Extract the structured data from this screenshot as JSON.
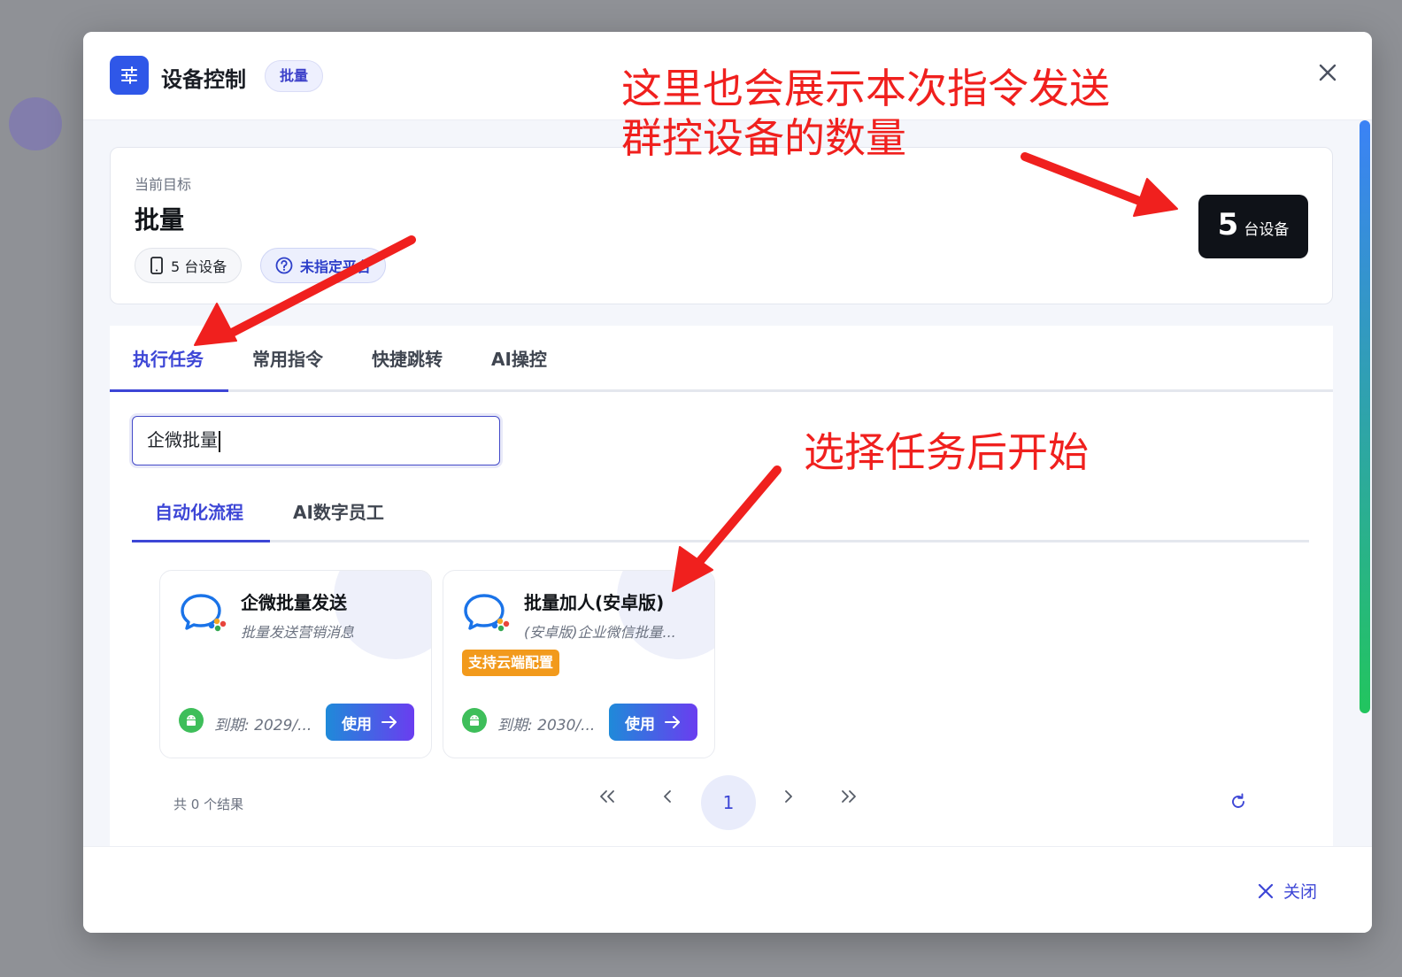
{
  "header": {
    "title": "设备控制",
    "badge": "批量"
  },
  "target": {
    "label": "当前目标",
    "name": "批量",
    "device_chip": "5 台设备",
    "platform_chip": "未指定平台",
    "count_number": "5",
    "count_unit": "台设备"
  },
  "tabs": {
    "items": [
      {
        "label": "执行任务"
      },
      {
        "label": "常用指令"
      },
      {
        "label": "快捷跳转"
      },
      {
        "label": "AI操控"
      }
    ]
  },
  "search": {
    "value": "企微批量"
  },
  "subtabs": {
    "items": [
      {
        "label": "自动化流程"
      },
      {
        "label": "AI数字员工"
      }
    ]
  },
  "cards": [
    {
      "title": "企微批量发送",
      "desc": "批量发送营销消息",
      "tag": "",
      "expiry": "到期: 2029/...",
      "button": "使用"
    },
    {
      "title": "批量加人(安卓版)",
      "desc": "(安卓版)企业微信批量...",
      "tag": "支持云端配置",
      "expiry": "到期: 2030/...",
      "button": "使用"
    }
  ],
  "pager": {
    "count_text": "共 0 个结果",
    "current_page": "1"
  },
  "footer": {
    "close_label": "关闭"
  },
  "annotations": {
    "top_line1": "这里也会展示本次指令发送",
    "top_line2": "群控设备的数量",
    "middle": "选择任务后开始"
  },
  "colors": {
    "accent": "#3d46d6",
    "annotation": "#f0201e",
    "tag": "#f29a1c"
  }
}
